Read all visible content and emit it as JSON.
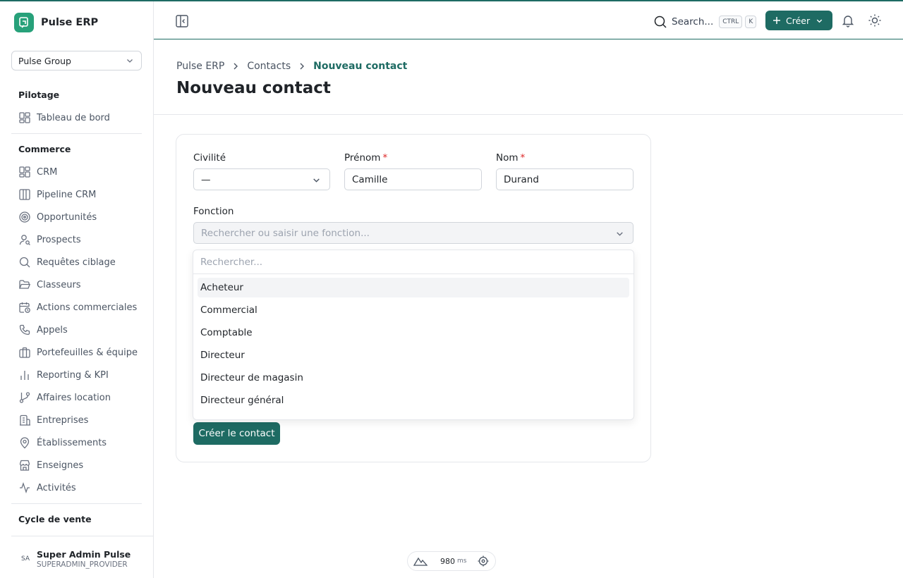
{
  "brand": {
    "name": "Pulse ERP"
  },
  "org_select": {
    "value": "Pulse Group"
  },
  "sidebar": {
    "sections": [
      {
        "title": "Pilotage",
        "items": [
          {
            "label": "Tableau de bord",
            "icon": "dashboard-icon"
          }
        ]
      },
      {
        "title": "Commerce",
        "items": [
          {
            "label": "CRM",
            "icon": "crm-icon"
          },
          {
            "label": "Pipeline CRM",
            "icon": "pipeline-icon"
          },
          {
            "label": "Opportunités",
            "icon": "target-icon"
          },
          {
            "label": "Prospects",
            "icon": "user-search-icon"
          },
          {
            "label": "Requêtes ciblage",
            "icon": "search-icon"
          },
          {
            "label": "Classeurs",
            "icon": "folder-open-icon"
          },
          {
            "label": "Actions commerciales",
            "icon": "calendar-clock-icon"
          },
          {
            "label": "Appels",
            "icon": "phone-icon"
          },
          {
            "label": "Portefeuilles & équipe",
            "icon": "briefcase-icon"
          },
          {
            "label": "Reporting & KPI",
            "icon": "bar-chart-icon"
          },
          {
            "label": "Affaires location",
            "icon": "git-branch-icon"
          },
          {
            "label": "Entreprises",
            "icon": "building-icon"
          },
          {
            "label": "Établissements",
            "icon": "map-pin-icon"
          },
          {
            "label": "Enseignes",
            "icon": "store-icon"
          },
          {
            "label": "Activités",
            "icon": "activity-icon"
          }
        ]
      },
      {
        "title": "Cycle de vente",
        "items": []
      }
    ]
  },
  "user": {
    "initials": "SA",
    "name": "Super Admin Pulse",
    "role": "SUPERADMIN_PROVIDER"
  },
  "header": {
    "search_label": "Search...",
    "shortcut_keys": [
      "CTRL",
      "K"
    ],
    "create_label": "Créer"
  },
  "breadcrumb": {
    "items": [
      "Pulse ERP",
      "Contacts"
    ],
    "current": "Nouveau contact"
  },
  "page_title": "Nouveau contact",
  "form": {
    "civilite": {
      "label": "Civilité",
      "value": "—"
    },
    "prenom": {
      "label": "Prénom",
      "required_mark": "*",
      "value": "Camille"
    },
    "nom": {
      "label": "Nom",
      "required_mark": "*",
      "value": "Durand"
    },
    "fonction": {
      "label": "Fonction",
      "placeholder": "Rechercher ou saisir une fonction..."
    },
    "submit_label": "Créer le contact"
  },
  "dropdown": {
    "search_placeholder": "Rechercher...",
    "options": [
      "Acheteur",
      "Commercial",
      "Comptable",
      "Directeur",
      "Directeur de magasin",
      "Directeur général"
    ]
  },
  "perf": {
    "value": "980",
    "unit": "ms"
  },
  "colors": {
    "accent": "#1e6b63",
    "brand_logo": "#27a17a",
    "required": "#dc2626"
  }
}
